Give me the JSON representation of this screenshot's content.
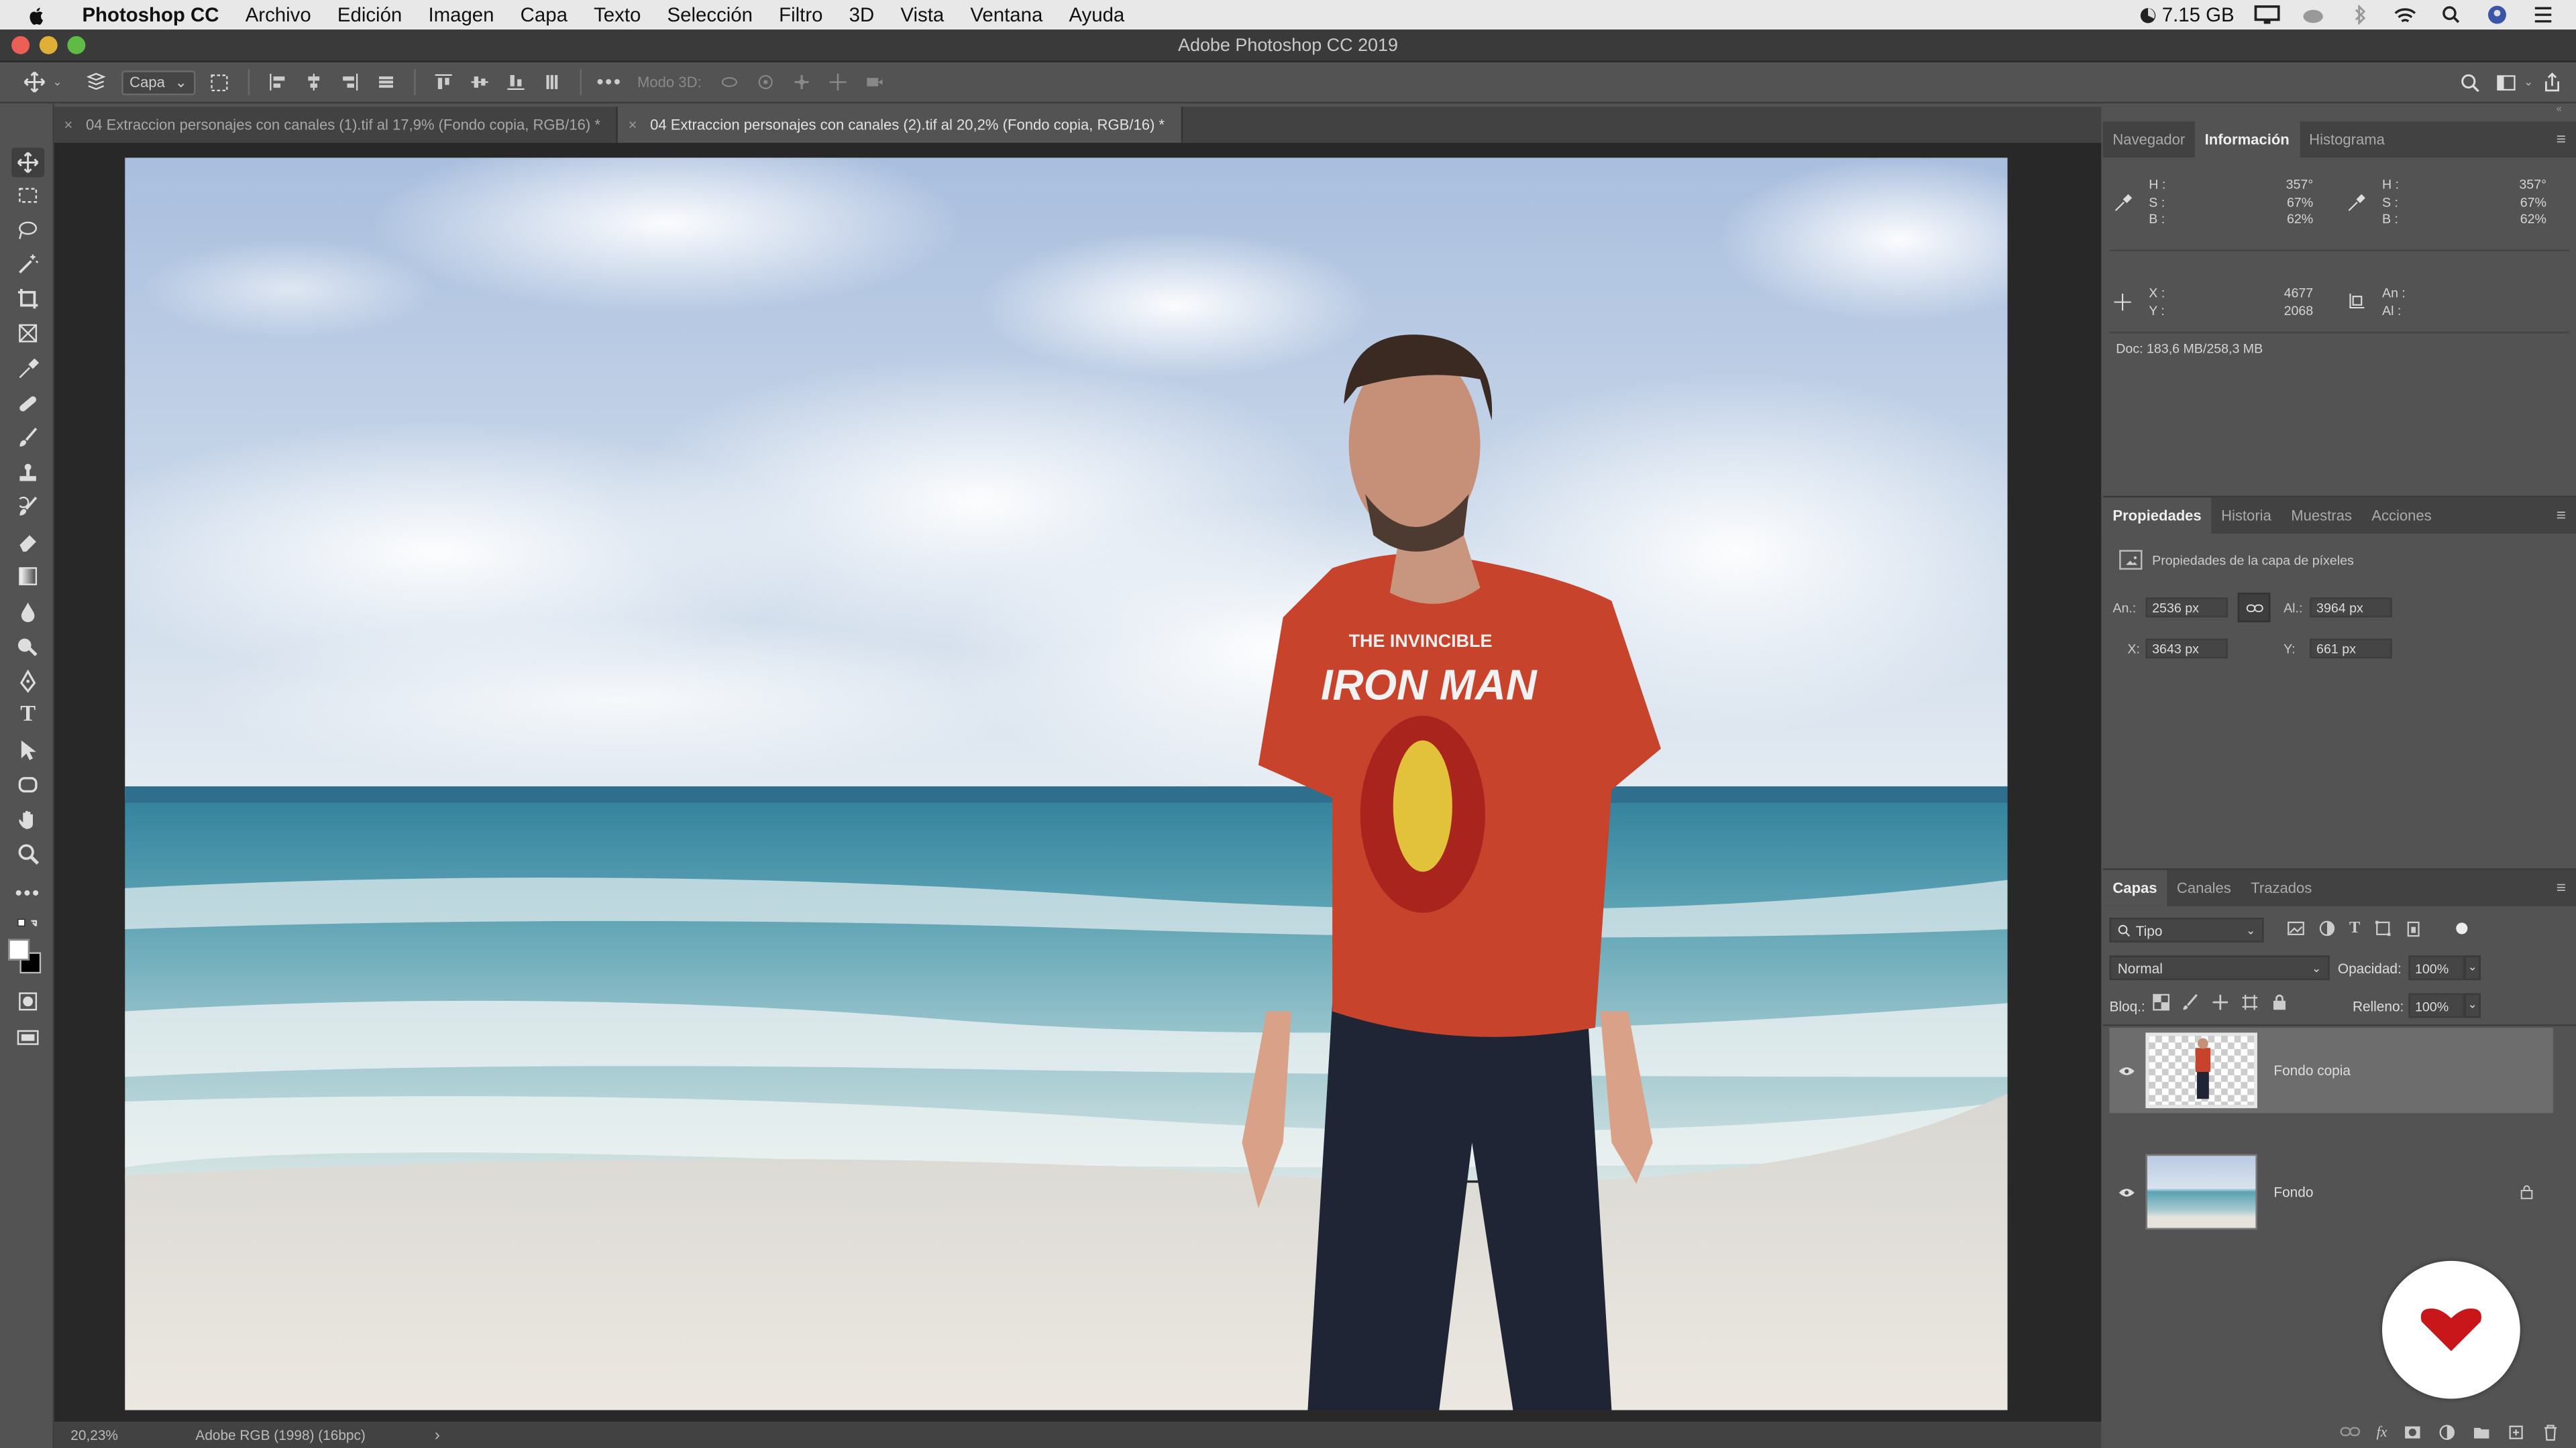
{
  "menubar": {
    "app": "Photoshop CC",
    "items": [
      "Archivo",
      "Edición",
      "Imagen",
      "Capa",
      "Texto",
      "Selección",
      "Filtro",
      "3D",
      "Vista",
      "Ventana",
      "Ayuda"
    ],
    "memory": "7.15 GB"
  },
  "window": {
    "title": "Adobe Photoshop CC 2019"
  },
  "options": {
    "auto_select": "Capa",
    "mode3d": "Modo 3D:"
  },
  "tabs": [
    {
      "label": "04 Extraccion personajes con canales (1).tif al 17,9% (Fondo copia, RGB/16) *"
    },
    {
      "label": "04 Extraccion personajes con canales (2).tif al 20,2% (Fondo copia, RGB/16) *"
    }
  ],
  "status": {
    "zoom": "20,23%",
    "profile": "Adobe RGB (1998) (16bpc)",
    "arrow": "›"
  },
  "info_panel": {
    "tabs": [
      "Navegador",
      "Información",
      "Histograma"
    ],
    "hsb1": {
      "h_label": "H :",
      "s_label": "S :",
      "b_label": "B :",
      "h": "357°",
      "s": "67%",
      "b": "62%"
    },
    "hsb2": {
      "h_label": "H :",
      "s_label": "S :",
      "b_label": "B :",
      "h": "357°",
      "s": "67%",
      "b": "62%"
    },
    "xy": {
      "x_label": "X :",
      "y_label": "Y :",
      "x": "4677",
      "y": "2068"
    },
    "size": {
      "w_label": "An :",
      "h_label": "Al :"
    },
    "doc": "Doc: 183,6 MB/258,3 MB"
  },
  "properties_panel": {
    "tabs": [
      "Propiedades",
      "Historia",
      "Muestras",
      "Acciones"
    ],
    "title": "Propiedades de la capa de píxeles",
    "w_label": "An.:",
    "w": "2536 px",
    "h_label": "Al.:",
    "h": "3964 px",
    "x_label": "X:",
    "x": "3643 px",
    "y_label": "Y:",
    "y": "661 px"
  },
  "layers_panel": {
    "tabs": [
      "Capas",
      "Canales",
      "Trazados"
    ],
    "filter": "Tipo",
    "blend": "Normal",
    "opacity_label": "Opacidad:",
    "opacity": "100%",
    "lock_label": "Bloq.:",
    "fill_label": "Relleno:",
    "fill": "100%",
    "layers": [
      {
        "name": "Fondo copia",
        "selected": true
      },
      {
        "name": "Fondo",
        "locked": true
      }
    ]
  },
  "colors": {
    "accent": "#c8171b",
    "panel": "#535353",
    "tab": "#424242"
  }
}
